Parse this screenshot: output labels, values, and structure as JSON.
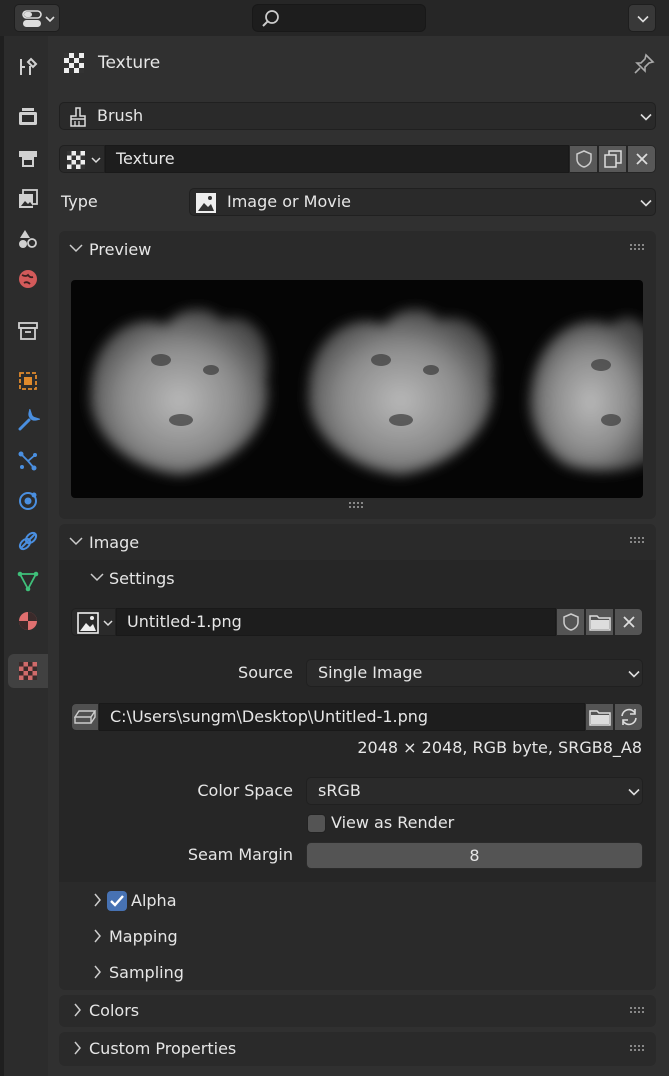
{
  "header": {
    "editor_type_icon": "properties-editor-icon",
    "search_placeholder": "",
    "menu_icon": "chevron-down-icon"
  },
  "sidebar": {
    "tabs": [
      {
        "name": "tool",
        "icon": "tool-icon"
      },
      {
        "name": "render",
        "icon": "render-icon"
      },
      {
        "name": "output",
        "icon": "output-icon"
      },
      {
        "name": "view-layer",
        "icon": "view-layer-icon"
      },
      {
        "name": "scene",
        "icon": "scene-icon"
      },
      {
        "name": "world",
        "icon": "world-icon"
      },
      {
        "name": "collection",
        "icon": "collection-icon"
      },
      {
        "name": "object",
        "icon": "object-icon"
      },
      {
        "name": "modifiers",
        "icon": "modifier-wrench-icon"
      },
      {
        "name": "particles",
        "icon": "particles-icon"
      },
      {
        "name": "physics",
        "icon": "physics-icon"
      },
      {
        "name": "constraints",
        "icon": "constraints-icon"
      },
      {
        "name": "data",
        "icon": "mesh-data-icon"
      },
      {
        "name": "material",
        "icon": "material-icon"
      },
      {
        "name": "texture",
        "icon": "texture-icon",
        "active": true
      }
    ]
  },
  "context": {
    "title": "Texture",
    "brush_label": "Brush",
    "texture_name": "Texture",
    "type_label": "Type",
    "type_value": "Image or Movie"
  },
  "preview": {
    "title": "Preview"
  },
  "image": {
    "title": "Image",
    "settings_title": "Settings",
    "image_name": "Untitled-1.png",
    "source_label": "Source",
    "source_value": "Single Image",
    "filepath": "C:\\Users\\sungm\\Desktop\\Untitled-1.png",
    "info": "2048 × 2048,  RGB byte,  SRGB8_A8",
    "color_space_label": "Color Space",
    "color_space_value": "sRGB",
    "view_as_render_label": "View as Render",
    "view_as_render_checked": false,
    "seam_margin_label": "Seam Margin",
    "seam_margin_value": "8",
    "alpha_label": "Alpha",
    "alpha_checked": true,
    "mapping_label": "Mapping",
    "sampling_label": "Sampling"
  },
  "colors": {
    "title": "Colors"
  },
  "custom_properties": {
    "title": "Custom Properties"
  },
  "theme": {
    "accent": "#4772b3",
    "background": "#303030",
    "panel": "#2a2a2a"
  }
}
